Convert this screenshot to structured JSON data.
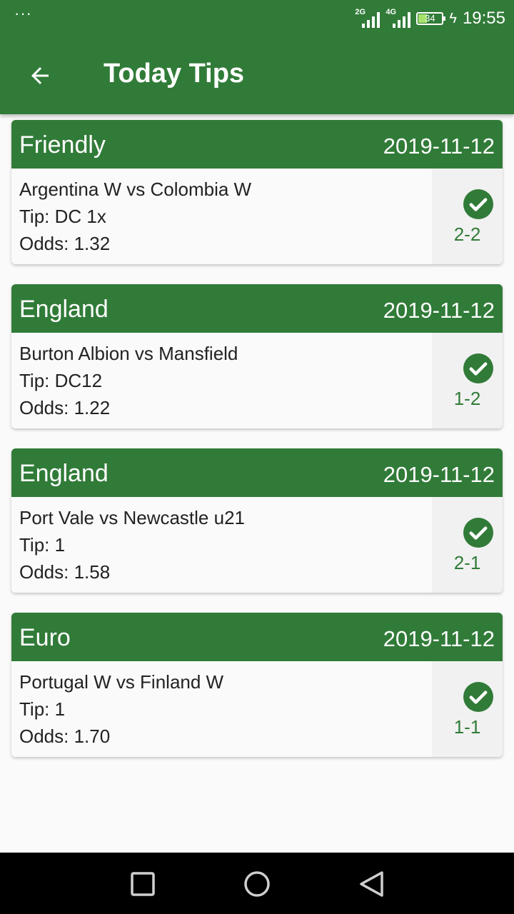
{
  "status_bar": {
    "dots": "···",
    "network_1": "2G",
    "network_2": "4G",
    "battery": "34",
    "time": "19:55"
  },
  "app_bar": {
    "title": "Today Tips",
    "back_icon": "arrow-left-icon"
  },
  "tips": [
    {
      "league": "Friendly",
      "date": "2019-11-12",
      "match": "Argentina W vs Colombia W",
      "tip": "Tip: DC 1x",
      "odds": "Odds: 1.32",
      "score": "2-2",
      "status_icon": "check-circle-icon"
    },
    {
      "league": "England",
      "date": "2019-11-12",
      "match": "Burton Albion vs Mansfield",
      "tip": "Tip: DC12",
      "odds": "Odds: 1.22",
      "score": "1-2",
      "status_icon": "check-circle-icon"
    },
    {
      "league": "England",
      "date": "2019-11-12",
      "match": "Port Vale vs Newcastle u21",
      "tip": "Tip: 1",
      "odds": "Odds: 1.58",
      "score": "2-1",
      "status_icon": "check-circle-icon"
    },
    {
      "league": "Euro",
      "date": "2019-11-12",
      "match": "Portugal W vs Finland W",
      "tip": "Tip: 1",
      "odds": "Odds: 1.70",
      "score": "1-1",
      "status_icon": "check-circle-icon"
    }
  ],
  "nav_bar": {
    "recents_icon": "square-icon",
    "home_icon": "circle-icon",
    "back_icon": "triangle-back-icon"
  },
  "colors": {
    "primary": "#317b38",
    "background": "#fafafa",
    "nav_bar": "#000000"
  }
}
